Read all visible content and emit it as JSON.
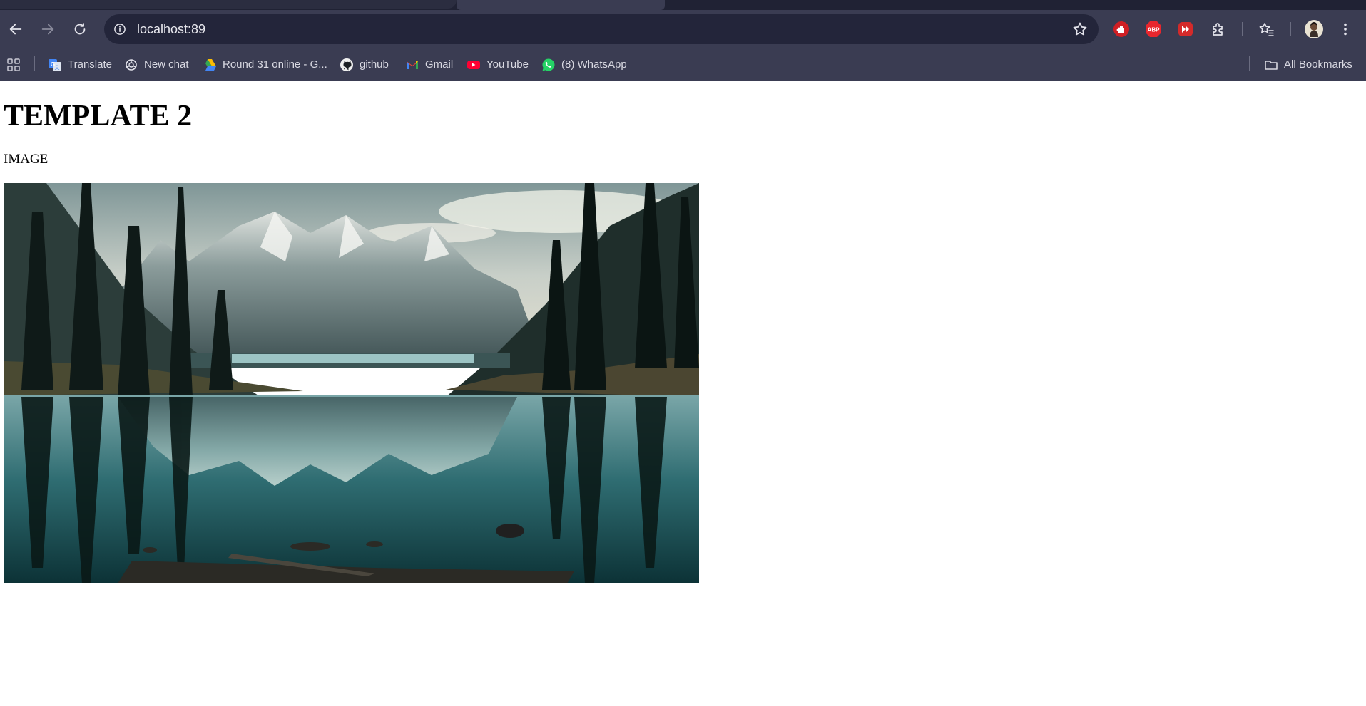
{
  "browser": {
    "address_bar": {
      "url": "localhost:89"
    },
    "icons": {
      "back": "arrow-left-icon",
      "forward": "arrow-right-icon",
      "reload": "reload-icon",
      "site_info": "info-icon",
      "bookmark_star": "star-icon",
      "ext_hand": "red-hand-icon",
      "ext_abp": "adblock-plus-icon",
      "ext_play": "red-play-icon",
      "extensions": "puzzle-icon",
      "reading_list": "star-list-icon",
      "profile": "avatar",
      "menu": "kebab-menu-icon",
      "apps": "apps-grid-icon",
      "folder": "folder-icon"
    },
    "ext_abp_text": "ABP"
  },
  "bookmarks": {
    "items": [
      {
        "label": "Translate",
        "icon": "google-translate-icon"
      },
      {
        "label": "New chat",
        "icon": "openai-icon"
      },
      {
        "label": "Round 31 online - G...",
        "icon": "google-drive-icon"
      },
      {
        "label": "github",
        "icon": "github-icon"
      },
      {
        "label": "Gmail",
        "icon": "gmail-icon"
      },
      {
        "label": "YouTube",
        "icon": "youtube-icon"
      },
      {
        "label": "(8) WhatsApp",
        "icon": "whatsapp-icon"
      }
    ],
    "all_bookmarks": "All Bookmarks"
  },
  "page": {
    "title": "TEMPLATE 2",
    "image_label": "IMAGE"
  },
  "colors": {
    "chrome_bg": "#3a3c52",
    "tabstrip_bg": "#202234",
    "omnibox_bg": "#23253a",
    "page_bg": "#ffffff"
  }
}
